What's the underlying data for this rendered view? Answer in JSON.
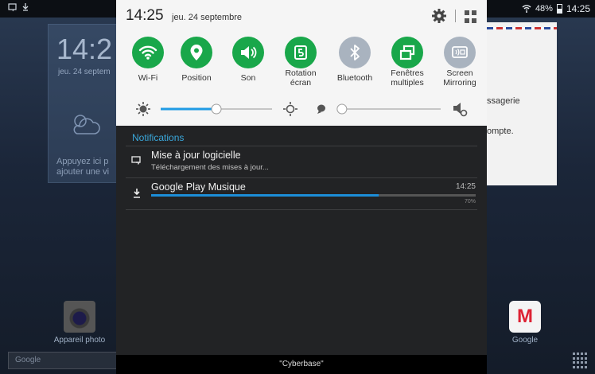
{
  "statusbar": {
    "battery_pct": "48%",
    "time": "14:25"
  },
  "home": {
    "clock_time": "14:2",
    "clock_date": "jeu. 24 septem",
    "widget_hint_line1": "Appuyez ici p",
    "widget_hint_line2": "ajouter une vi",
    "mail_line1": "ssagerie",
    "mail_line2": "ompte.",
    "app_camera": "Appareil photo",
    "app_gmail": "Google",
    "search_placeholder": "Google"
  },
  "panel": {
    "time": "14:25",
    "date": "jeu. 24 septembre",
    "tiles": [
      {
        "label": "Wi-Fi",
        "icon": "wifi-icon",
        "active": true
      },
      {
        "label": "Position",
        "icon": "location-pin-icon",
        "active": true
      },
      {
        "label": "Son",
        "icon": "volume-icon",
        "active": true
      },
      {
        "label_line1": "Rotation",
        "label_line2": "écran",
        "icon": "screen-rotation-icon",
        "active": true
      },
      {
        "label": "Bluetooth",
        "icon": "bluetooth-icon",
        "active": false
      },
      {
        "label_line1": "Fenêtres",
        "label_line2": "multiples",
        "icon": "multi-window-icon",
        "active": true
      },
      {
        "label_line1": "Screen",
        "label_line2": "Mirroring",
        "icon": "screen-mirroring-icon",
        "active": false
      }
    ],
    "brightness_level": 0.5,
    "second_slider_level": 0.03,
    "notifications_title": "Notifications",
    "notifications": [
      {
        "title": "Mise à jour logicielle",
        "subtitle": "Téléchargement des mises à jour...",
        "icon": "system-update-icon"
      },
      {
        "title": "Google Play Musique",
        "time": "14:25",
        "progress": 0.7,
        "percent": "70%",
        "icon": "download-icon"
      }
    ],
    "carrier": "\"Cyberbase\""
  },
  "colors": {
    "accent_green": "#19a74a",
    "inactive_gray": "#a9b3bf",
    "notif_blue": "#3aa8dc",
    "progress_blue": "#1c8ed8"
  }
}
